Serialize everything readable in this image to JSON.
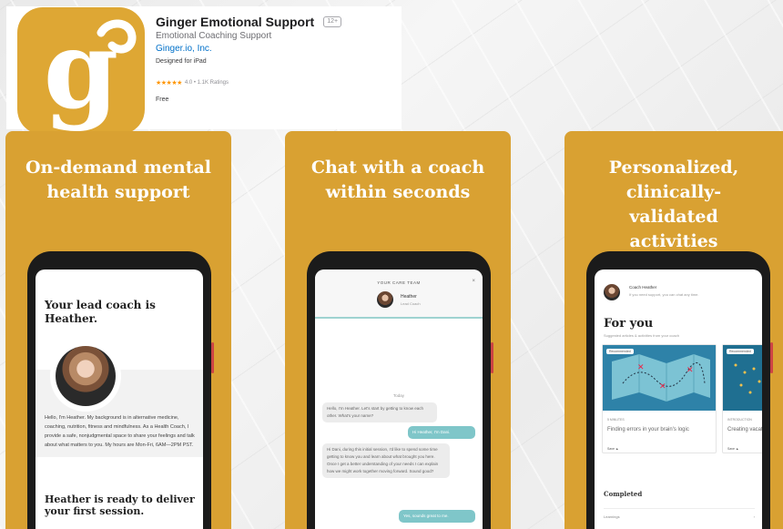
{
  "app": {
    "title": "Ginger Emotional Support",
    "age_rating": "12+",
    "subtitle": "Emotional Coaching Support",
    "developer": "Ginger.io, Inc.",
    "designed_for": "Designed for iPad",
    "stars": "★★★★★",
    "rating_text": "4.0 • 1.1K Ratings",
    "price": "Free",
    "icon_letter": "g",
    "icon_color": "#dea734"
  },
  "screenshots": [
    {
      "heading": "On-demand mental health support",
      "lead_title": "Your lead coach is Heather.",
      "bio": "Hello, I'm Heather. My background is in alternative medicine, coaching, nutrition, fitness and mindfulness. As a Health Coach, I provide a safe, nonjudgmental space to share your feelings and talk about what matters to you. My hours are Mon-Fri, 6AM—2PM PST.",
      "ready_text": "Heather is ready to deliver your first session."
    },
    {
      "heading": "Chat with a coach within seconds",
      "team_label": "YOUR CARE TEAM",
      "close_glyph": "×",
      "coach_name": "Heather",
      "coach_role": "Lead Coach",
      "day_label": "Today",
      "messages": [
        {
          "from": "coach",
          "text": "Hello, I'm Heather. Let's start by getting to know each other. What's your name?"
        },
        {
          "from": "me",
          "text": "Hi Heather, I'm Dani."
        },
        {
          "from": "coach",
          "text": "Hi Dani, during this initial session, I'd like to spend some time getting to know you and learn about what brought you here. Once I get a better understanding of your needs I can explain how we might work together moving forward. Sound good?"
        },
        {
          "from": "me",
          "text": "Yes, sounds great to me."
        }
      ]
    },
    {
      "heading": "Personalized, clinically-validated activities",
      "coach_label": "Coach Heather",
      "coach_sub": "If you need support, you can chat any time.",
      "for_you": "For you",
      "suggested": "Suggested articles & activities from your coach",
      "cards": [
        {
          "tag": "Recommended",
          "kicker": "5 MINUTES",
          "title": "Finding errors in your brain's logic",
          "link": "Save ▲"
        },
        {
          "tag": "Recommended",
          "kicker": "INTRODUCTION",
          "title": "Creating vacation",
          "link": "Save ▲"
        }
      ],
      "completed_label": "Completed",
      "completed_row": "Learnings",
      "completed_arrow": "›"
    }
  ],
  "colors": {
    "card_bg": "#d9a132",
    "chat_accent": "#7fc6c9",
    "map_blue": "#2e82a8"
  }
}
